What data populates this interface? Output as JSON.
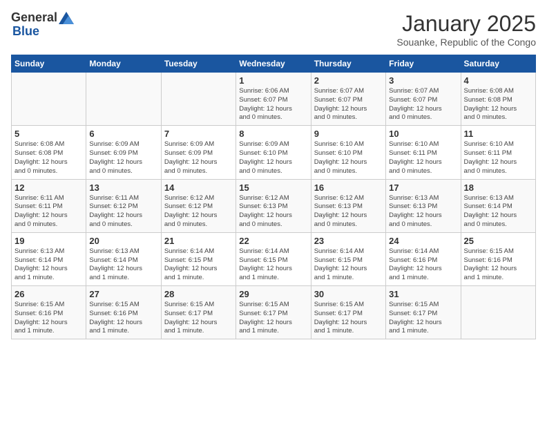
{
  "logo": {
    "general": "General",
    "blue": "Blue"
  },
  "title": "January 2025",
  "location": "Souanke, Republic of the Congo",
  "weekdays": [
    "Sunday",
    "Monday",
    "Tuesday",
    "Wednesday",
    "Thursday",
    "Friday",
    "Saturday"
  ],
  "weeks": [
    [
      {
        "day": "",
        "info": ""
      },
      {
        "day": "",
        "info": ""
      },
      {
        "day": "",
        "info": ""
      },
      {
        "day": "1",
        "info": "Sunrise: 6:06 AM\nSunset: 6:07 PM\nDaylight: 12 hours\nand 0 minutes."
      },
      {
        "day": "2",
        "info": "Sunrise: 6:07 AM\nSunset: 6:07 PM\nDaylight: 12 hours\nand 0 minutes."
      },
      {
        "day": "3",
        "info": "Sunrise: 6:07 AM\nSunset: 6:07 PM\nDaylight: 12 hours\nand 0 minutes."
      },
      {
        "day": "4",
        "info": "Sunrise: 6:08 AM\nSunset: 6:08 PM\nDaylight: 12 hours\nand 0 minutes."
      }
    ],
    [
      {
        "day": "5",
        "info": "Sunrise: 6:08 AM\nSunset: 6:08 PM\nDaylight: 12 hours\nand 0 minutes."
      },
      {
        "day": "6",
        "info": "Sunrise: 6:09 AM\nSunset: 6:09 PM\nDaylight: 12 hours\nand 0 minutes."
      },
      {
        "day": "7",
        "info": "Sunrise: 6:09 AM\nSunset: 6:09 PM\nDaylight: 12 hours\nand 0 minutes."
      },
      {
        "day": "8",
        "info": "Sunrise: 6:09 AM\nSunset: 6:10 PM\nDaylight: 12 hours\nand 0 minutes."
      },
      {
        "day": "9",
        "info": "Sunrise: 6:10 AM\nSunset: 6:10 PM\nDaylight: 12 hours\nand 0 minutes."
      },
      {
        "day": "10",
        "info": "Sunrise: 6:10 AM\nSunset: 6:11 PM\nDaylight: 12 hours\nand 0 minutes."
      },
      {
        "day": "11",
        "info": "Sunrise: 6:10 AM\nSunset: 6:11 PM\nDaylight: 12 hours\nand 0 minutes."
      }
    ],
    [
      {
        "day": "12",
        "info": "Sunrise: 6:11 AM\nSunset: 6:11 PM\nDaylight: 12 hours\nand 0 minutes."
      },
      {
        "day": "13",
        "info": "Sunrise: 6:11 AM\nSunset: 6:12 PM\nDaylight: 12 hours\nand 0 minutes."
      },
      {
        "day": "14",
        "info": "Sunrise: 6:12 AM\nSunset: 6:12 PM\nDaylight: 12 hours\nand 0 minutes."
      },
      {
        "day": "15",
        "info": "Sunrise: 6:12 AM\nSunset: 6:13 PM\nDaylight: 12 hours\nand 0 minutes."
      },
      {
        "day": "16",
        "info": "Sunrise: 6:12 AM\nSunset: 6:13 PM\nDaylight: 12 hours\nand 0 minutes."
      },
      {
        "day": "17",
        "info": "Sunrise: 6:13 AM\nSunset: 6:13 PM\nDaylight: 12 hours\nand 0 minutes."
      },
      {
        "day": "18",
        "info": "Sunrise: 6:13 AM\nSunset: 6:14 PM\nDaylight: 12 hours\nand 0 minutes."
      }
    ],
    [
      {
        "day": "19",
        "info": "Sunrise: 6:13 AM\nSunset: 6:14 PM\nDaylight: 12 hours\nand 1 minute."
      },
      {
        "day": "20",
        "info": "Sunrise: 6:13 AM\nSunset: 6:14 PM\nDaylight: 12 hours\nand 1 minute."
      },
      {
        "day": "21",
        "info": "Sunrise: 6:14 AM\nSunset: 6:15 PM\nDaylight: 12 hours\nand 1 minute."
      },
      {
        "day": "22",
        "info": "Sunrise: 6:14 AM\nSunset: 6:15 PM\nDaylight: 12 hours\nand 1 minute."
      },
      {
        "day": "23",
        "info": "Sunrise: 6:14 AM\nSunset: 6:15 PM\nDaylight: 12 hours\nand 1 minute."
      },
      {
        "day": "24",
        "info": "Sunrise: 6:14 AM\nSunset: 6:16 PM\nDaylight: 12 hours\nand 1 minute."
      },
      {
        "day": "25",
        "info": "Sunrise: 6:15 AM\nSunset: 6:16 PM\nDaylight: 12 hours\nand 1 minute."
      }
    ],
    [
      {
        "day": "26",
        "info": "Sunrise: 6:15 AM\nSunset: 6:16 PM\nDaylight: 12 hours\nand 1 minute."
      },
      {
        "day": "27",
        "info": "Sunrise: 6:15 AM\nSunset: 6:16 PM\nDaylight: 12 hours\nand 1 minute."
      },
      {
        "day": "28",
        "info": "Sunrise: 6:15 AM\nSunset: 6:17 PM\nDaylight: 12 hours\nand 1 minute."
      },
      {
        "day": "29",
        "info": "Sunrise: 6:15 AM\nSunset: 6:17 PM\nDaylight: 12 hours\nand 1 minute."
      },
      {
        "day": "30",
        "info": "Sunrise: 6:15 AM\nSunset: 6:17 PM\nDaylight: 12 hours\nand 1 minute."
      },
      {
        "day": "31",
        "info": "Sunrise: 6:15 AM\nSunset: 6:17 PM\nDaylight: 12 hours\nand 1 minute."
      },
      {
        "day": "",
        "info": ""
      }
    ]
  ]
}
